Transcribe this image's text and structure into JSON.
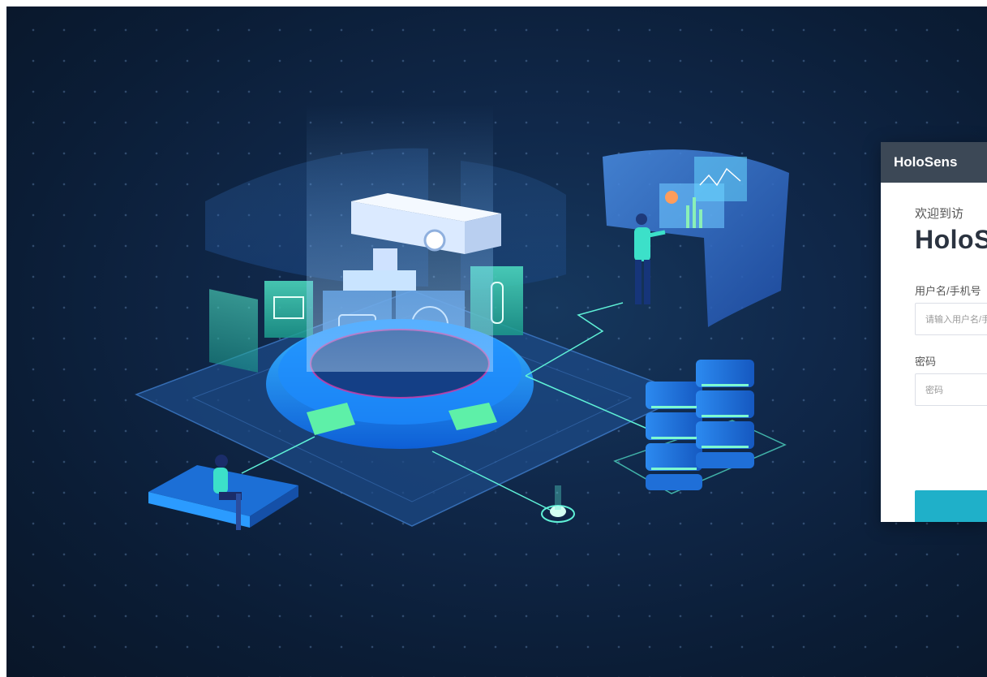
{
  "brand": {
    "name": "HoloSens"
  },
  "login": {
    "welcome": "欢迎到访",
    "title": "HoloS",
    "username_label": "用户名/手机号",
    "username_placeholder": "请输入用户名/手",
    "password_label": "密码",
    "password_placeholder": "密码",
    "login_button": ""
  },
  "colors": {
    "background": "#0b1d36",
    "header": "#3c4856",
    "accent": "#1fb0c9",
    "glow": "#2a8cff"
  },
  "icons": [
    "security-camera-icon",
    "car-icon",
    "truck-icon",
    "helmet-icon",
    "traffic-light-icon",
    "shirt-icon",
    "server-icon",
    "dashboard-chart-icon"
  ]
}
